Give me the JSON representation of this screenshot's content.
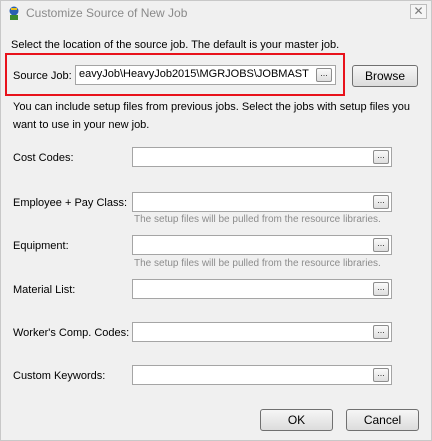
{
  "window": {
    "title": "Customize Source of New Job",
    "close_glyph": "✕"
  },
  "intro_text": "Select the location of the source job. The default is your master job.",
  "source_job": {
    "label": "Source Job:",
    "value": "eavyJob\\HeavyJob2015\\MGRJOBS\\JOBMAST",
    "browse_glyph": "...",
    "browse_button": "Browse"
  },
  "setup_intro": {
    "line1": "You can include setup files from previous jobs. Select the jobs with setup files you",
    "line2": "want to use in your new job."
  },
  "fields": [
    {
      "label": "Cost Codes:",
      "value": "",
      "browse_glyph": "...",
      "hint": ""
    },
    {
      "label": "Employee + Pay Class:",
      "value": "",
      "browse_glyph": "...",
      "hint": "The setup files will be pulled from the resource libraries."
    },
    {
      "label": "Equipment:",
      "value": "",
      "browse_glyph": "...",
      "hint": "The setup files will be pulled from the resource libraries."
    },
    {
      "label": "Material List:",
      "value": "",
      "browse_glyph": "...",
      "hint": ""
    },
    {
      "label": "Worker's Comp. Codes:",
      "value": "",
      "browse_glyph": "...",
      "hint": ""
    },
    {
      "label": "Custom Keywords:",
      "value": "",
      "browse_glyph": "...",
      "hint": ""
    }
  ],
  "buttons": {
    "ok": "OK",
    "cancel": "Cancel"
  }
}
